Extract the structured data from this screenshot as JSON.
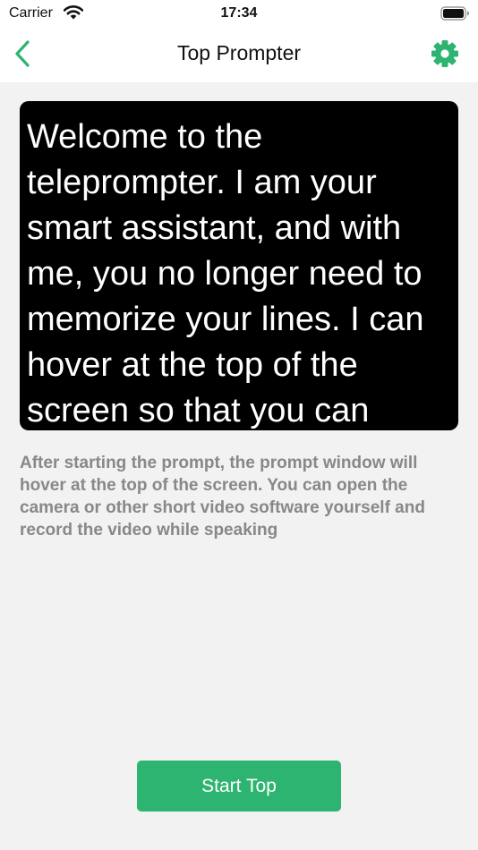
{
  "status_bar": {
    "carrier": "Carrier",
    "time": "17:34",
    "icons": [
      "wifi-icon",
      "battery-icon"
    ]
  },
  "nav": {
    "title": "Top Prompter",
    "back_icon": "chevron-left-icon",
    "settings_icon": "gear-icon"
  },
  "colors": {
    "accent": "#2db470",
    "preview_bg": "#000000",
    "preview_text": "#ffffff",
    "description_text": "#888888",
    "background": "#f2f2f2"
  },
  "prompt": {
    "text": "Welcome to the teleprompter. I am your smart assistant, and with me, you no longer need to memorize your lines. I can hover at the top of the screen so that you can"
  },
  "description": "After starting the prompt, the prompt window will hover at the top of the screen. You can open the camera or other short video software yourself and record the video while speaking",
  "start_button": {
    "label": "Start Top"
  }
}
